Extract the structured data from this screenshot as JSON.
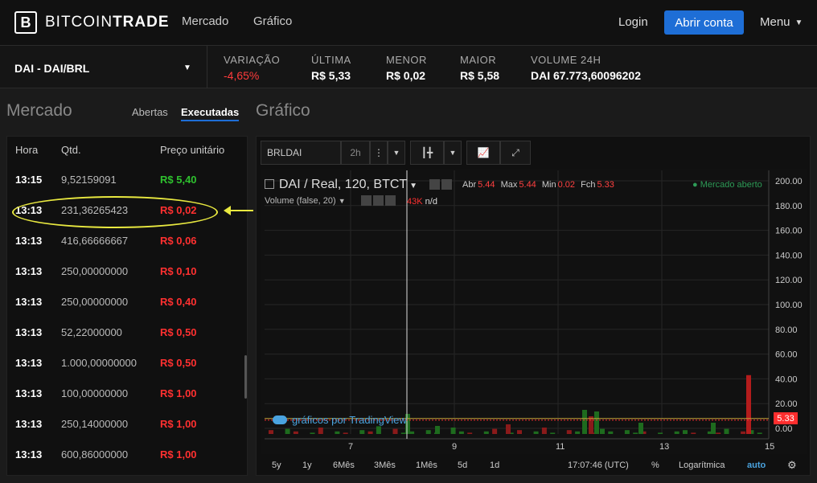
{
  "header": {
    "logo_letter": "B",
    "logo_light": "BITCOIN",
    "logo_bold": "TRADE",
    "nav": [
      "Mercado",
      "Gráfico"
    ],
    "login": "Login",
    "open_account": "Abrir conta",
    "menu": "Menu"
  },
  "ticker": {
    "pair": "DAI - DAI/BRL",
    "stats": [
      {
        "label": "VARIAÇÃO",
        "value": "-4,65%",
        "color": "#ff3b3b"
      },
      {
        "label": "ÚLTIMA",
        "value": "R$ 5,33"
      },
      {
        "label": "MENOR",
        "value": "R$ 0,02"
      },
      {
        "label": "MAIOR",
        "value": "R$ 5,58"
      },
      {
        "label": "VOLUME 24H",
        "value": "DAI 67.773,60096202"
      }
    ]
  },
  "market": {
    "title": "Mercado",
    "tabs": [
      "Abertas",
      "Executadas"
    ],
    "active_tab": "Executadas",
    "columns": [
      "Hora",
      "Qtd.",
      "Preço unitário"
    ],
    "rows": [
      {
        "time": "13:15",
        "qty": "9,52159091",
        "price": "R$ 5,40",
        "side": "buy"
      },
      {
        "time": "13:13",
        "qty": "231,36265423",
        "price": "R$ 0,02",
        "side": "sell"
      },
      {
        "time": "13:13",
        "qty": "416,66666667",
        "price": "R$ 0,06",
        "side": "sell"
      },
      {
        "time": "13:13",
        "qty": "250,00000000",
        "price": "R$ 0,10",
        "side": "sell"
      },
      {
        "time": "13:13",
        "qty": "250,00000000",
        "price": "R$ 0,40",
        "side": "sell"
      },
      {
        "time": "13:13",
        "qty": "52,22000000",
        "price": "R$ 0,50",
        "side": "sell"
      },
      {
        "time": "13:13",
        "qty": "1.000,00000000",
        "price": "R$ 0,50",
        "side": "sell"
      },
      {
        "time": "13:13",
        "qty": "100,00000000",
        "price": "R$ 1,00",
        "side": "sell"
      },
      {
        "time": "13:13",
        "qty": "250,14000000",
        "price": "R$ 1,00",
        "side": "sell"
      },
      {
        "time": "13:13",
        "qty": "600,86000000",
        "price": "R$ 1,00",
        "side": "sell"
      }
    ]
  },
  "chart": {
    "title": "Gráfico",
    "symbol": "BRLDAI",
    "interval": "2h",
    "legend": "DAI / Real, 120, BTCT",
    "ohlc": {
      "abr_label": "Abr",
      "abr": "5.44",
      "max_label": "Max",
      "max": "5.44",
      "min_label": "Min",
      "min": "0.02",
      "fch_label": "Fch",
      "fch": "5.33"
    },
    "volume_label": "Volume (false, 20)",
    "volume_value": "43K",
    "volume_na": "n/d",
    "market_status": "● Mercado aberto",
    "tv_credit": "gráficos por TradingView",
    "last_price": "5.33",
    "bottom": {
      "ranges": [
        "5y",
        "1y",
        "6Mês",
        "3Mês",
        "1Mês",
        "5d",
        "1d"
      ],
      "time": "17:07:46 (UTC)",
      "percent": "%",
      "log": "Logarítmica",
      "auto": "auto"
    }
  },
  "chart_data": {
    "type": "bar",
    "title": "DAI / Real, 120, BTCT",
    "x_ticks": [
      "7",
      "9",
      "11",
      "13",
      "15"
    ],
    "y_ticks": [
      "200.00",
      "180.00",
      "160.00",
      "140.00",
      "120.00",
      "100.00",
      "80.00",
      "60.00",
      "40.00",
      "20.00",
      "0.00"
    ],
    "ylim": [
      0,
      210
    ],
    "series": [
      {
        "values": [
          5.2,
          5.3,
          5.4,
          5.35,
          5.3,
          5.4,
          5.45,
          5.4,
          5.3,
          5.35,
          5.4,
          5.33
        ]
      }
    ],
    "last_close": 5.33,
    "spike_high": 43
  }
}
